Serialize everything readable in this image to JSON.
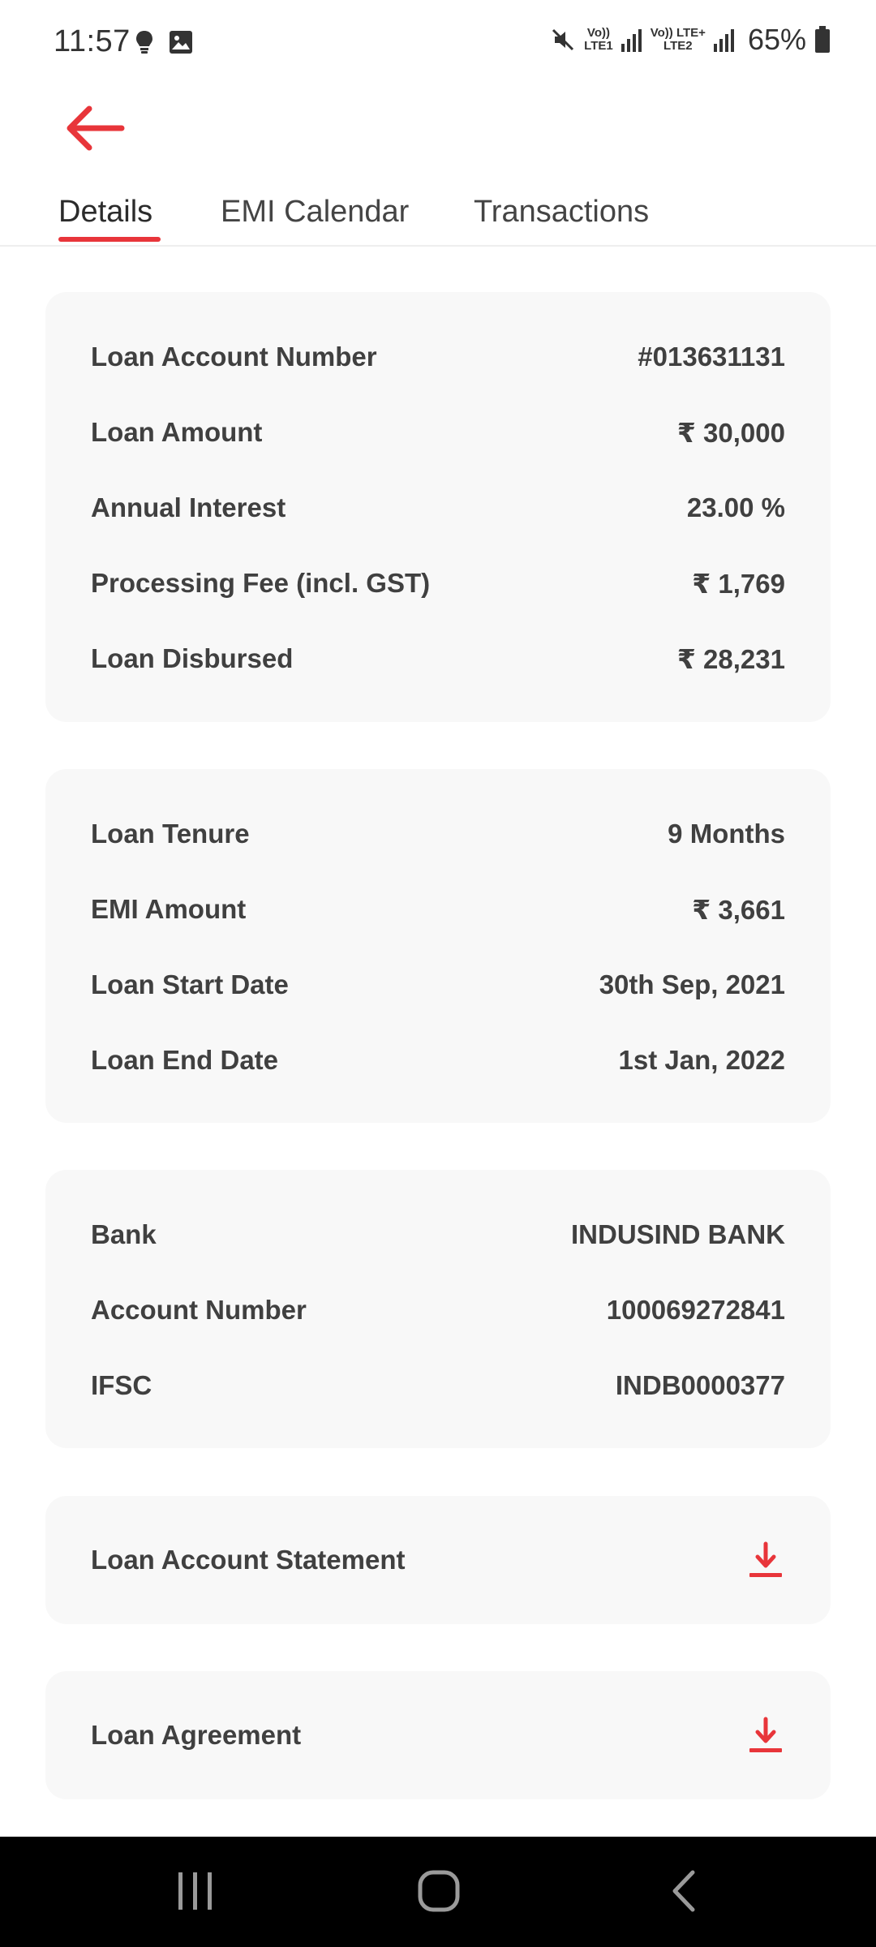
{
  "status_bar": {
    "time": "11:57",
    "battery": "65%",
    "net1_top": "Vo))",
    "net1_bottom": "LTE1",
    "net2_top": "Vo)) LTE+",
    "net2_bottom": "LTE2"
  },
  "tabs": [
    {
      "label": "Details",
      "active": true
    },
    {
      "label": "EMI Calendar",
      "active": false
    },
    {
      "label": "Transactions",
      "active": false
    }
  ],
  "loan_details": {
    "account_number": {
      "label": "Loan Account Number",
      "value": "#013631131"
    },
    "amount": {
      "label": "Loan Amount",
      "value": "₹ 30,000"
    },
    "interest": {
      "label": "Annual Interest",
      "value": "23.00 %"
    },
    "processing_fee": {
      "label": "Processing Fee (incl. GST)",
      "value": "₹ 1,769"
    },
    "disbursed": {
      "label": "Loan Disbursed",
      "value": "₹ 28,231"
    }
  },
  "emi_details": {
    "tenure": {
      "label": "Loan Tenure",
      "value": "9 Months"
    },
    "emi_amount": {
      "label": "EMI Amount",
      "value": "₹ 3,661"
    },
    "start_date": {
      "label": "Loan Start Date",
      "value": "30th Sep, 2021"
    },
    "end_date": {
      "label": "Loan End Date",
      "value": "1st Jan, 2022"
    }
  },
  "bank_details": {
    "bank": {
      "label": "Bank",
      "value": "INDUSIND BANK"
    },
    "account_number": {
      "label": "Account Number",
      "value": "100069272841"
    },
    "ifsc": {
      "label": "IFSC",
      "value": "INDB0000377"
    }
  },
  "documents": {
    "statement": {
      "label": "Loan Account Statement",
      "icon": "download-icon"
    },
    "agreement": {
      "label": "Loan Agreement",
      "icon": "download-icon"
    }
  },
  "colors": {
    "accent": "#e8353a",
    "card_bg": "#f8f8f8"
  }
}
